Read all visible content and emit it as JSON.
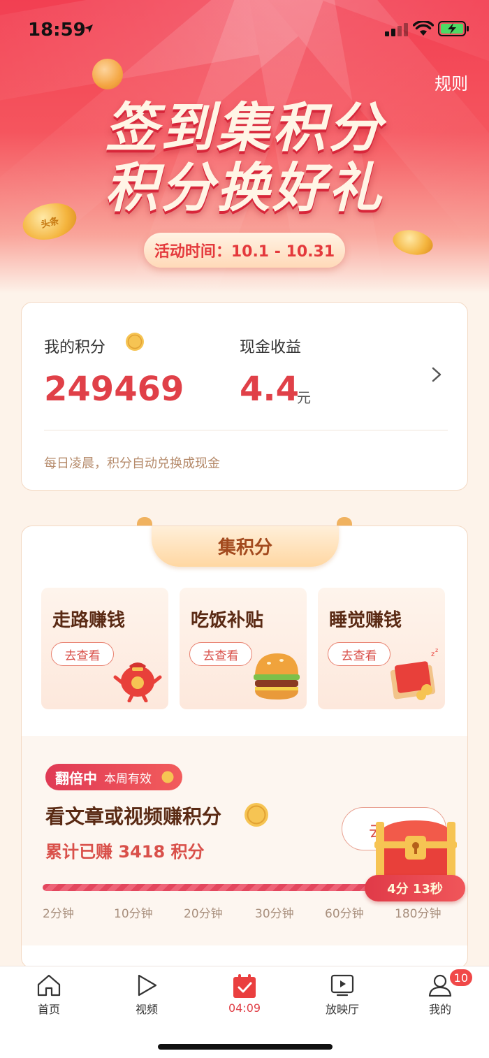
{
  "status_bar": {
    "time": "18:59"
  },
  "header": {
    "rules_label": "规则",
    "title_line1": "签到集积分",
    "title_line2": "积分换好礼",
    "period": "活动时间：10.1 - 10.31",
    "coin_text": "头条"
  },
  "points_card": {
    "my_points_label": "我的积分",
    "my_points_value": "249469",
    "cash_label": "现金收益",
    "cash_value": "4.4",
    "cash_unit": "元",
    "note": "每日凌晨，积分自动兑换成现金"
  },
  "collect": {
    "section_title": "集积分",
    "tasks": [
      {
        "title": "走路赚钱",
        "button": "去查看",
        "icon": "lucky-bag-icon"
      },
      {
        "title": "吃饭补贴",
        "button": "去查看",
        "icon": "burger-icon"
      },
      {
        "title": "睡觉赚钱",
        "button": "去查看",
        "icon": "red-envelope-icon"
      }
    ],
    "read": {
      "badge_main": "翻倍中",
      "badge_sub": "本周有效",
      "title": "看文章或视频赚积分",
      "earned": "累计已赚 3418 积分",
      "go_button": "去",
      "progress_fraction": 1.0,
      "ticks": [
        "2分钟",
        "10分钟",
        "20分钟",
        "30分钟",
        "60分钟",
        "180分钟"
      ]
    },
    "chest_timer": "4分 13秒"
  },
  "tabbar": {
    "tabs": [
      {
        "label": "首页",
        "icon": "home-icon"
      },
      {
        "label": "视频",
        "icon": "play-icon"
      },
      {
        "label": "04:09",
        "icon": "calendar-check-icon",
        "active": true
      },
      {
        "label": "放映厅",
        "icon": "tv-play-icon"
      },
      {
        "label": "我的",
        "icon": "user-icon",
        "badge": "10"
      }
    ]
  },
  "colors": {
    "accent": "#e04048",
    "brand_red": "#f23f52",
    "page_bg": "#fdf3ea"
  }
}
